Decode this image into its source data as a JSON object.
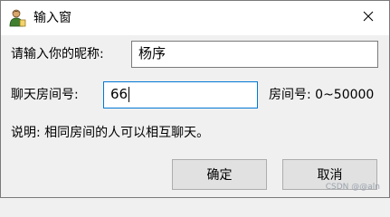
{
  "window": {
    "title": "输入窗",
    "app_icon": "user-icon",
    "close_icon": "close-icon"
  },
  "nickname": {
    "label": "请输入你的昵称:",
    "value": "杨序"
  },
  "room": {
    "label": "聊天房间号:",
    "value": "66",
    "range_hint": "房间号: 0~50000"
  },
  "note": "说明: 相同房间的人可以相互聊天。",
  "buttons": {
    "ok": "确定",
    "cancel": "取消"
  },
  "watermark": "CSDN @@aln",
  "colors": {
    "focus_border": "#0078d7",
    "titlebar_bg": "#ffffff",
    "dialog_bg": "#f0f0f0"
  }
}
